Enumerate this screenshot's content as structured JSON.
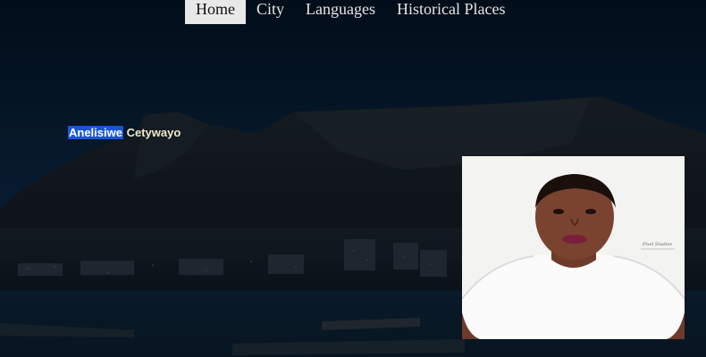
{
  "nav": {
    "items": [
      {
        "label": "Home",
        "active": true
      },
      {
        "label": "City",
        "active": false
      },
      {
        "label": "Languages",
        "active": false
      },
      {
        "label": "Historical Places",
        "active": false
      }
    ]
  },
  "profile": {
    "first_name": "Anelisiwe",
    "last_name": "Cetywayo",
    "photo_watermark": "Pixel Studios"
  },
  "colors": {
    "selection_highlight": "#1a55d6",
    "nav_active_bg": "#e8e8e8",
    "background_dark": "#061a2c"
  }
}
